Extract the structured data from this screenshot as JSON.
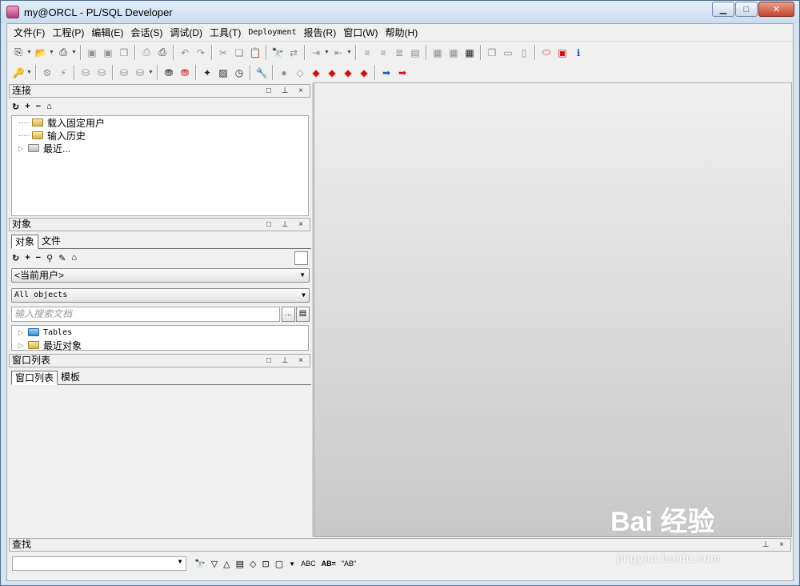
{
  "window": {
    "title": "my@ORCL - PL/SQL Developer",
    "minimize": "▁",
    "maximize": "□",
    "close": "✕"
  },
  "menu": [
    "文件(F)",
    "工程(P)",
    "编辑(E)",
    "会话(S)",
    "调试(D)",
    "工具(T)",
    "Deployment",
    "报告(R)",
    "窗口(W)",
    "帮助(H)"
  ],
  "toolbar1": [
    "new-icon",
    "open-icon",
    "print-icon",
    "save-icon",
    "save-all-icon",
    "copy-doc-icon",
    "printer-icon",
    "print-setup-icon",
    "undo-icon",
    "redo-icon",
    "cut-icon",
    "copy-icon",
    "paste-icon",
    "find-icon",
    "replace-icon",
    "indent-icon",
    "unindent-icon",
    "comment-icon",
    "uncomment-icon",
    "window-icon",
    "oracle-icon",
    "pdf-icon",
    "info-icon"
  ],
  "toolbar2": [
    "key-icon",
    "gear-icon",
    "lightning-icon",
    "db-icon",
    "db2-icon",
    "execute-icon",
    "commit-icon",
    "rollback-icon",
    "wrench-icon",
    "arrow-right-icon",
    "arrow-left-icon"
  ],
  "panels": {
    "connection": {
      "title": "连接",
      "controls": "□ ⊥ ×",
      "tools": [
        "↻",
        "+",
        "−",
        "⌂"
      ],
      "tree": [
        "载入固定用户",
        "输入历史",
        "最近..."
      ]
    },
    "objects": {
      "title": "对象",
      "controls": "□ ⊥ ×",
      "tabs": [
        "对象",
        "文件"
      ],
      "tools": [
        "↻",
        "+",
        "−",
        "⚲",
        "✎",
        "⌂"
      ],
      "user_combo": "<当前用户>",
      "filter_combo": "All objects",
      "search_placeholder": "输入搜索文档",
      "browse_btn": "...",
      "tree": [
        "Tables",
        "最近对象"
      ]
    },
    "window_list": {
      "title": "窗口列表",
      "controls": "□ ⊥ ×",
      "tabs": [
        "窗口列表",
        "模板"
      ]
    }
  },
  "find": {
    "title": "查找",
    "controls": "⊥ ×",
    "tools": [
      "🔭",
      "▽",
      "△",
      "▤",
      "◇",
      "⊡",
      "▢",
      "ABC",
      "AB=",
      "\"AB\""
    ]
  },
  "watermark": {
    "main": "Bai 经验",
    "sub": "jingyan.baidu.com"
  }
}
